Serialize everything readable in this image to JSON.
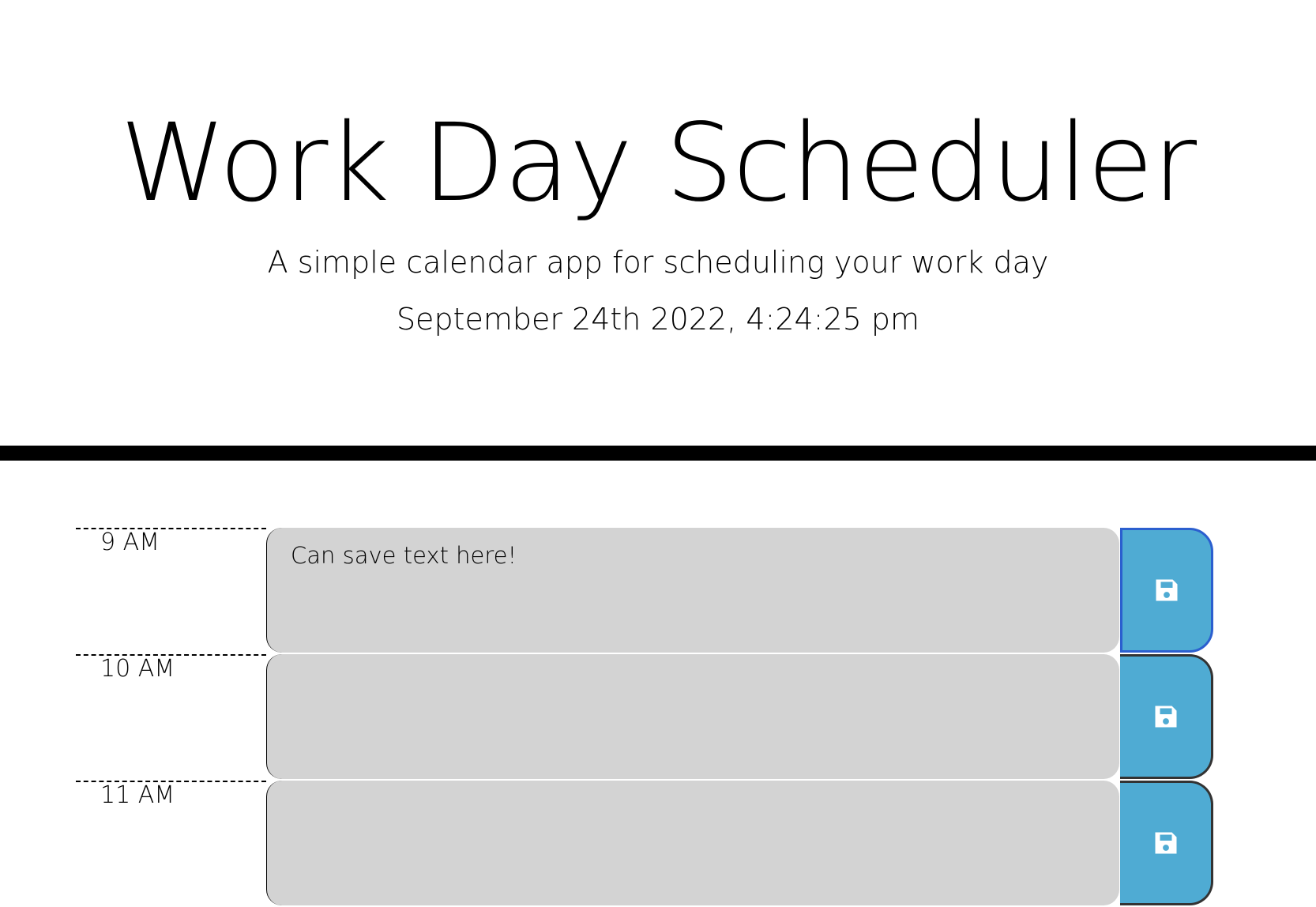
{
  "header": {
    "title": "Work Day Scheduler",
    "lead": "A simple calendar app for scheduling your work day",
    "current_datetime": "September 24th 2022, 4:24:25 pm"
  },
  "time_blocks": [
    {
      "hour_label": "9 AM",
      "text": "Can save text here!",
      "save_icon": "save-icon"
    },
    {
      "hour_label": "10 AM",
      "text": "",
      "save_icon": "save-icon"
    },
    {
      "hour_label": "11 AM",
      "text": "",
      "save_icon": "save-icon"
    }
  ],
  "colors": {
    "textarea_background": "#d3d3d3",
    "save_button_background": "#4fabd3",
    "header_rule": "#000000"
  }
}
